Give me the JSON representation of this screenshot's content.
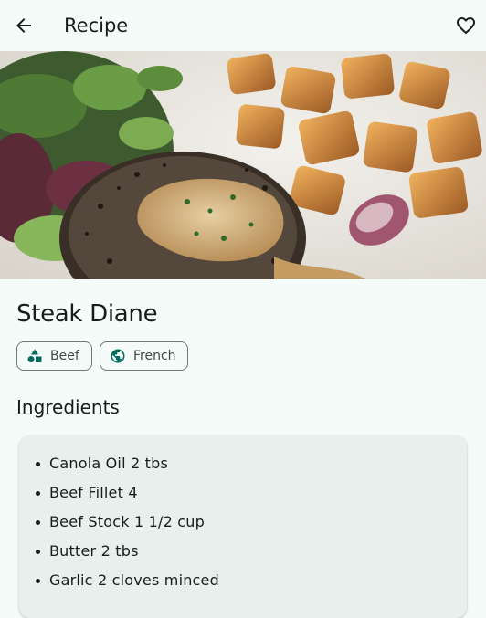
{
  "appbar": {
    "title": "Recipe",
    "back_icon": "arrow-back-icon",
    "favorite_icon": "heart-outline-icon"
  },
  "hero": {
    "image": "steak-with-potatoes-photo"
  },
  "recipe": {
    "title": "Steak Diane",
    "chips": [
      {
        "label": "Beef",
        "icon": "category-shapes-icon"
      },
      {
        "label": "French",
        "icon": "globe-icon"
      }
    ]
  },
  "ingredients": {
    "heading": "Ingredients",
    "items": [
      "Canola Oil 2 tbs",
      "Beef Fillet 4",
      "Beef Stock 1 1/2 cup",
      "Butter 2 tbs",
      "Garlic 2 cloves minced"
    ]
  },
  "colors": {
    "background": "#f4fbf8",
    "accent": "#006b5e",
    "card": "#e8efec",
    "text": "#171d1b"
  }
}
